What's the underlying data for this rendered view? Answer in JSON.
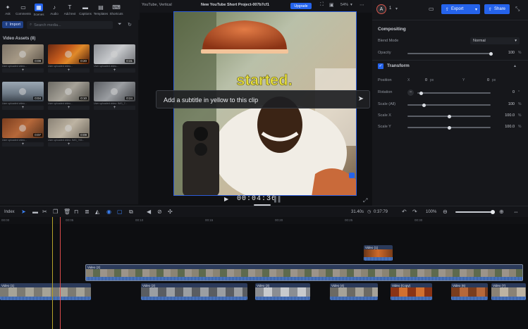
{
  "toolbar": {
    "items": [
      {
        "label": "Ask",
        "icon": "sparkle-icon"
      },
      {
        "label": "Comments",
        "icon": "comment-icon"
      },
      {
        "label": "Scenes",
        "icon": "scenes-icon"
      },
      {
        "label": "Audio",
        "icon": "music-icon"
      },
      {
        "label": "Add text",
        "icon": "text-icon"
      },
      {
        "label": "Captions",
        "icon": "captions-icon"
      },
      {
        "label": "Templates",
        "icon": "templates-icon"
      },
      {
        "label": "Shortcuts",
        "icon": "keyboard-icon"
      }
    ],
    "active_index": 2
  },
  "left_panel": {
    "import_label": "Import",
    "search_placeholder": "Search media...",
    "assets_title": "Video Assets (8)",
    "assets": [
      {
        "caption": "User uploaded video...",
        "duration": "0:09"
      },
      {
        "caption": "User uploaded video...",
        "duration": "0:20"
      },
      {
        "caption": "User uploaded video...",
        "duration": "0:31"
      },
      {
        "caption": "User uploaded video...",
        "duration": "0:04"
      },
      {
        "caption": "User uploaded video...",
        "duration": "0:10"
      },
      {
        "caption": "User uploaded video: IMG_7...",
        "duration": "0:24"
      },
      {
        "caption": "User uploaded video...",
        "duration": "0:07"
      },
      {
        "caption": "User uploaded video: IMG_745...",
        "duration": "0:09"
      }
    ],
    "add_label": "+"
  },
  "header": {
    "format": "YouTube, Vertical",
    "project_title": "New YouTube Short Project-007b7cf1",
    "upgrade_label": "Upgrade",
    "zoom": "54%",
    "user_initial": "A",
    "user_count": "1",
    "export_label": "Export",
    "share_label": "Share"
  },
  "preview": {
    "overlay_text": "started.",
    "prompt_text": "Add a subtitle in yellow to this clip",
    "timecode": "00:04:36"
  },
  "properties": {
    "compositing_title": "Compositing",
    "blend_mode_label": "Blend Mode",
    "blend_mode_value": "Normal",
    "opacity_label": "Opacity",
    "opacity_value": "100",
    "opacity_unit": "%",
    "transform_title": "Transform",
    "position_label": "Position",
    "position_x_label": "X",
    "position_x_value": "0",
    "position_y_label": "Y",
    "position_y_value": "0",
    "px_unit": "px",
    "rotation_label": "Rotation",
    "rotation_value": "0",
    "rotation_unit": "°",
    "scale_all_label": "Scale (All)",
    "scale_all_value": "100",
    "scale_x_label": "Scale X",
    "scale_x_value": "100.0",
    "scale_y_label": "Scale Y",
    "scale_y_value": "100.0",
    "pct_unit": "%",
    "levels": {
      "opacity": 1.0,
      "scale_all": 0.2,
      "scale_x": 0.5,
      "scale_y": 0.5,
      "rotation": 0.05
    }
  },
  "timeline": {
    "index_label": "Index",
    "time_display": "31.40s",
    "duration_display": "0:37:79",
    "zoom_label": "100%",
    "ruler_ticks": [
      "00:00",
      "00:05",
      "00:10",
      "00:15",
      "00:20",
      "00:25",
      "00:30"
    ],
    "clips": [
      {
        "label": "Video (1)",
        "track": 1
      },
      {
        "label": "Video (2)",
        "track": 2
      },
      {
        "label": "Video (1)",
        "track": 3
      },
      {
        "label": "Video (2)",
        "track": 3
      },
      {
        "label": "Video (3)",
        "track": 3
      },
      {
        "label": "Video (4)",
        "track": 3
      },
      {
        "label": "Video (5)",
        "track": 3
      },
      {
        "label": "Video (Copy)",
        "track": 3
      },
      {
        "label": "Video (6)",
        "track": 3
      },
      {
        "label": "Video (7)",
        "track": 3
      }
    ]
  },
  "colors": {
    "accent": "#2563eb",
    "caption_yellow": "#e8e03a",
    "playhead": "#d94a4a"
  }
}
